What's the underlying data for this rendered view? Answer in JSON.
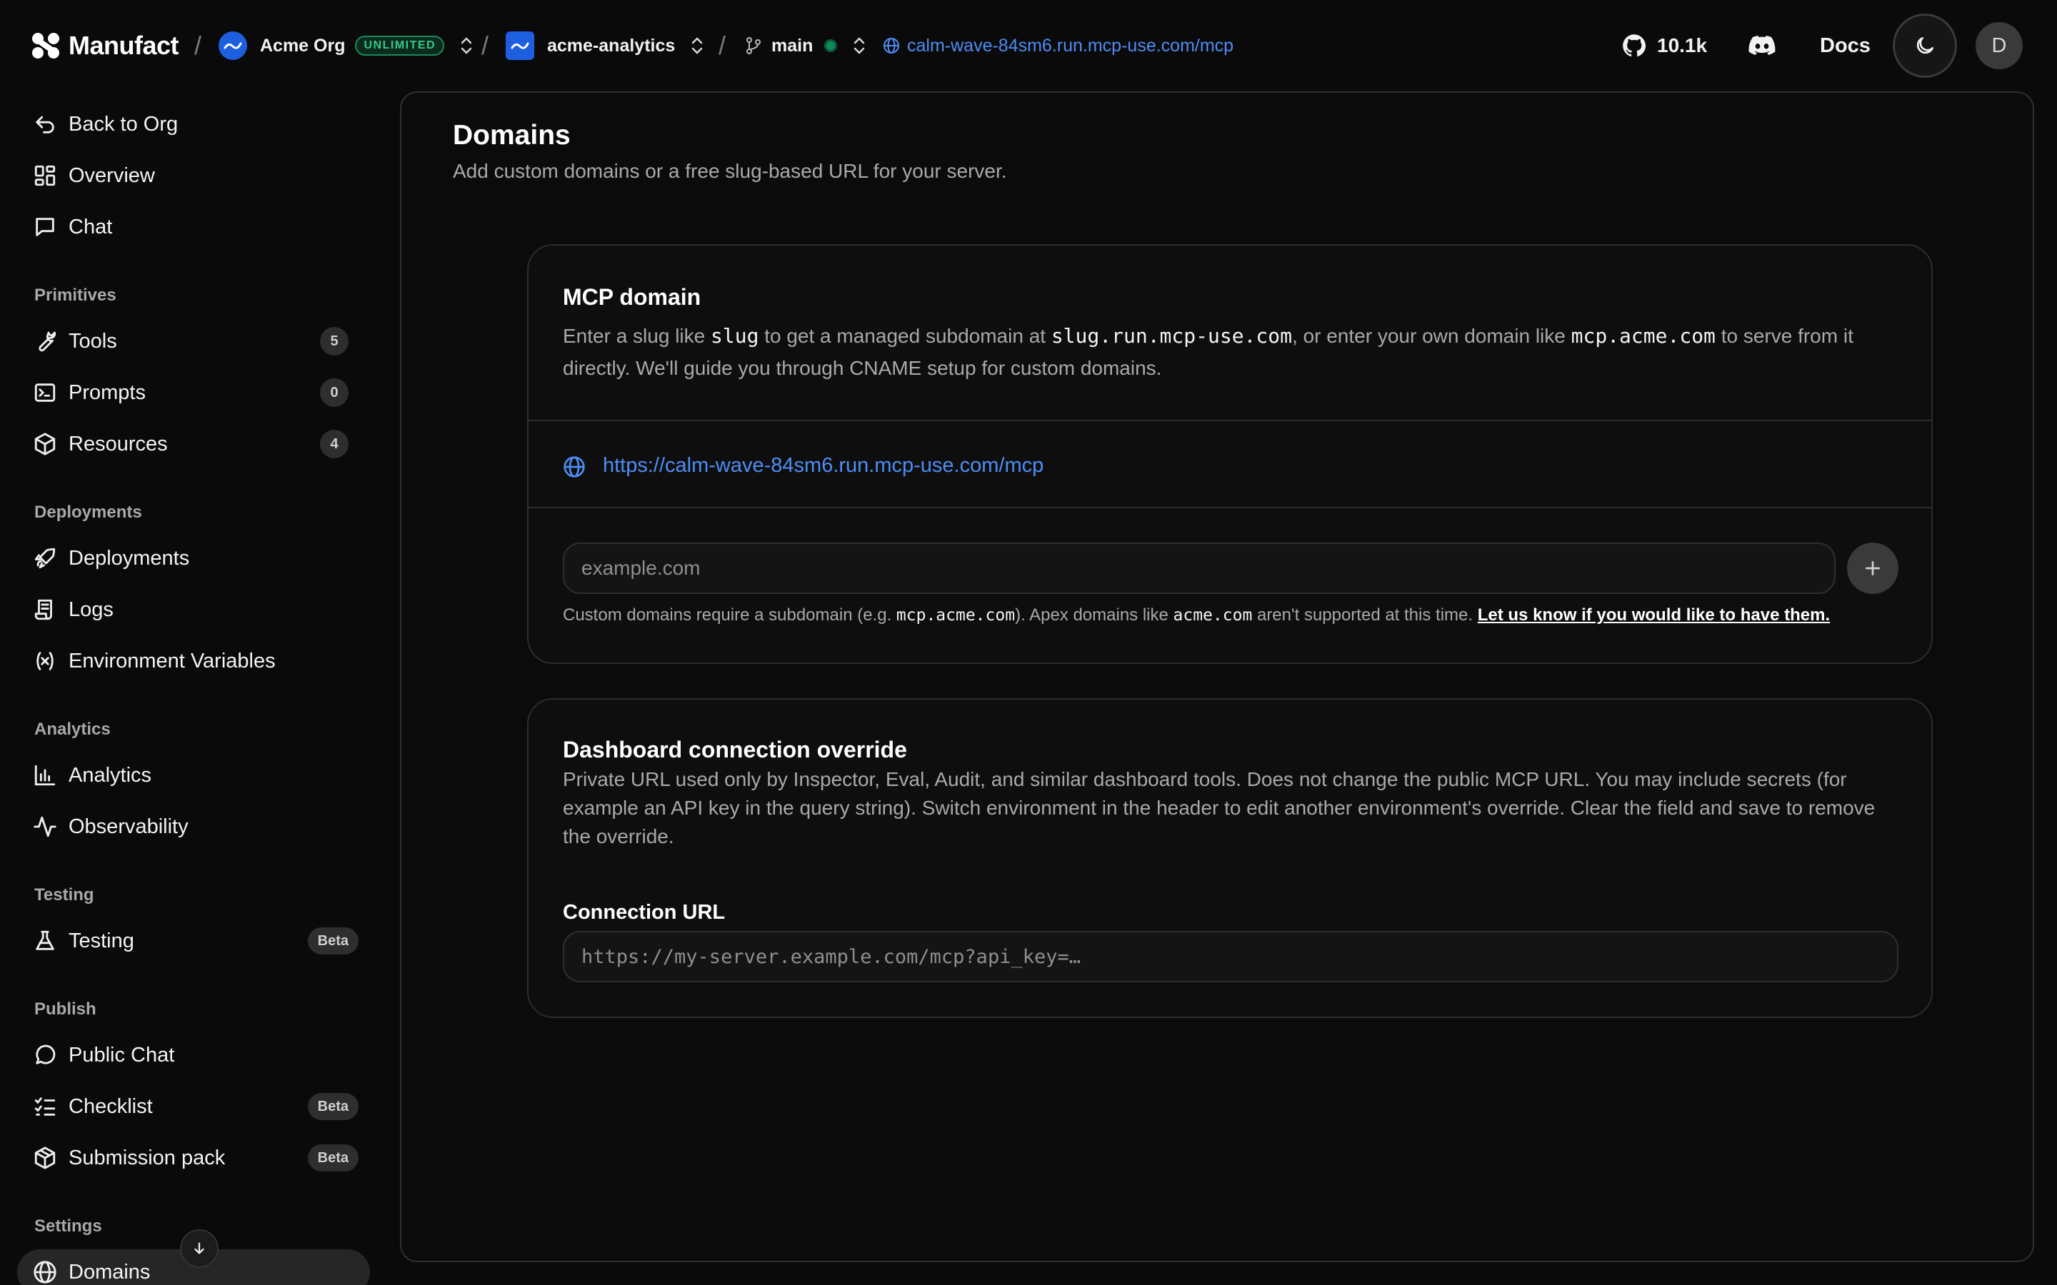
{
  "header": {
    "brand": "Manufact",
    "org_name": "Acme Org",
    "org_badge": "UNLIMITED",
    "project_name": "acme-analytics",
    "branch": "main",
    "server_url": "calm-wave-84sm6.run.mcp-use.com/mcp",
    "github_stars": "10.1k",
    "docs_label": "Docs",
    "user_initial": "D"
  },
  "sidebar": {
    "back": "Back to Org",
    "top_items": [
      {
        "label": "Overview",
        "icon": "grid-icon"
      },
      {
        "label": "Chat",
        "icon": "chat-icon"
      }
    ],
    "sections": {
      "primitives": "Primitives",
      "deployments": "Deployments",
      "analytics": "Analytics",
      "testing": "Testing",
      "publish": "Publish",
      "settings": "Settings"
    },
    "primitives": [
      {
        "label": "Tools",
        "count": "5"
      },
      {
        "label": "Prompts",
        "count": "0"
      },
      {
        "label": "Resources",
        "count": "4"
      }
    ],
    "deployments": [
      {
        "label": "Deployments"
      },
      {
        "label": "Logs"
      },
      {
        "label": "Environment Variables"
      }
    ],
    "analytics": [
      {
        "label": "Analytics"
      },
      {
        "label": "Observability"
      }
    ],
    "testing": [
      {
        "label": "Testing",
        "badge": "Beta"
      }
    ],
    "publish": [
      {
        "label": "Public Chat"
      },
      {
        "label": "Checklist",
        "badge": "Beta"
      },
      {
        "label": "Submission pack",
        "badge": "Beta"
      }
    ],
    "settings": [
      {
        "label": "Domains"
      }
    ]
  },
  "page": {
    "title": "Domains",
    "subtitle": "Add custom domains or a free slug-based URL for your server."
  },
  "mcp_card": {
    "title": "MCP domain",
    "desc_1": "Enter a slug like ",
    "desc_code_1": "slug",
    "desc_2": " to get a managed subdomain at ",
    "desc_code_2": "slug.run.mcp-use.com",
    "desc_3": ", or enter your own domain like ",
    "desc_code_3": "mcp.acme.com",
    "desc_4": " to serve from it directly. We'll guide you through CNAME setup for custom domains.",
    "current_url": "https://calm-wave-84sm6.run.mcp-use.com/mcp",
    "input_placeholder": "example.com",
    "help_1": "Custom domains require a subdomain (e.g. ",
    "help_code_1": "mcp.acme.com",
    "help_2": "). Apex domains like ",
    "help_code_2": "acme.com",
    "help_3": " aren't supported at this time. ",
    "help_link": "Let us know if you would like to have them."
  },
  "override_card": {
    "title": "Dashboard connection override",
    "desc": "Private URL used only by Inspector, Eval, Audit, and similar dashboard tools. Does not change the public MCP URL. You may include secrets (for example an API key in the query string). Switch environment in the header to edit another environment's override. Clear the field and save to remove the override.",
    "field_label": "Connection URL",
    "field_placeholder": "https://my-server.example.com/mcp?api_key=…"
  },
  "colors": {
    "background": "#0a0a0a",
    "link": "#4d8ef7",
    "brand_blue": "#1e5fe0",
    "status_green": "#0e8a5a"
  }
}
